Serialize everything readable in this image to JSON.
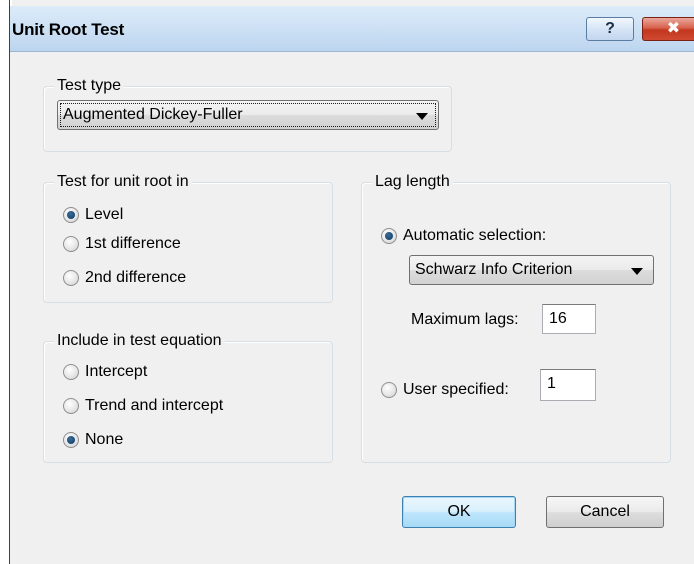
{
  "window": {
    "title": "Unit Root Test",
    "help_label": "?",
    "close_label": "✖"
  },
  "test_type": {
    "legend": "Test type",
    "selected": "Augmented Dickey-Fuller"
  },
  "unit_root_in": {
    "legend": "Test for unit root in",
    "options": [
      {
        "label": "Level",
        "checked": true
      },
      {
        "label": "1st difference",
        "checked": false
      },
      {
        "label": "2nd difference",
        "checked": false
      }
    ]
  },
  "include_in_equation": {
    "legend": "Include in test equation",
    "options": [
      {
        "label": "Intercept",
        "checked": false
      },
      {
        "label": "Trend and intercept",
        "checked": false
      },
      {
        "label": "None",
        "checked": true
      }
    ]
  },
  "lag_length": {
    "legend": "Lag length",
    "automatic_label": "Automatic selection:",
    "automatic_checked": true,
    "criterion_selected": "Schwarz Info Criterion",
    "max_lags_label": "Maximum lags:",
    "max_lags_value": "16",
    "user_specified_label": "User specified:",
    "user_specified_checked": false,
    "user_specified_value": "1"
  },
  "buttons": {
    "ok_label": "OK",
    "cancel_label": "Cancel"
  }
}
